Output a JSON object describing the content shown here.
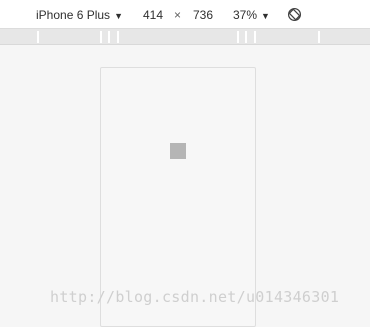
{
  "toolbar": {
    "device_label": "iPhone 6 Plus",
    "device_arrow": "▼",
    "width_value": "414",
    "times_symbol": "×",
    "height_value": "736",
    "zoom_label": "37%",
    "zoom_arrow": "▼",
    "rotate_icon": "rotate-icon"
  },
  "viewport": {
    "placeholder_icon": "broken-image-icon"
  },
  "watermark": {
    "text": "http://blog.csdn.net/u014346301"
  }
}
